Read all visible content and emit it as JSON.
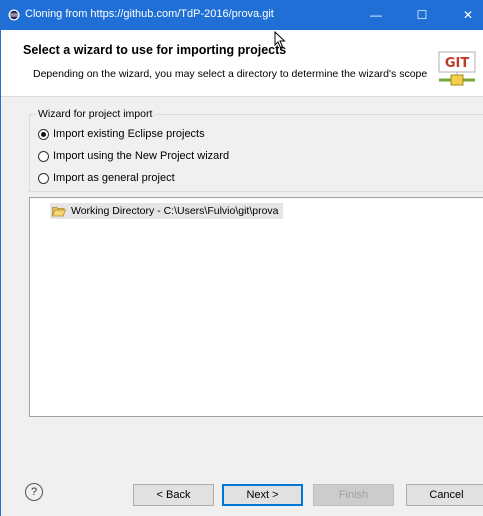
{
  "window": {
    "title": "Cloning from https://github.com/TdP-2016/prova.git",
    "controls": {
      "minimize": "—",
      "maximize": "☐",
      "close": "✕"
    }
  },
  "header": {
    "title": "Select a wizard to use for importing projects",
    "description": "Depending on the wizard, you may select a directory to determine the wizard's scope",
    "logo_text": "GIT"
  },
  "wizard_group": {
    "legend": "Wizard for project import",
    "options": [
      {
        "label": "Import existing Eclipse projects",
        "selected": true
      },
      {
        "label": "Import using the New Project wizard",
        "selected": false
      },
      {
        "label": "Import as general project",
        "selected": false
      }
    ]
  },
  "tree": {
    "items": [
      {
        "label": "Working Directory - C:\\Users\\Fulvio\\git\\prova",
        "icon": "folder-open-icon"
      }
    ]
  },
  "buttons": {
    "help": "?",
    "back": "< Back",
    "next": "Next >",
    "finish": "Finish",
    "cancel": "Cancel"
  },
  "colors": {
    "titlebar": "#1f6fd6",
    "dialog_bg": "#f0f0f0",
    "accent": "#0078d7"
  }
}
